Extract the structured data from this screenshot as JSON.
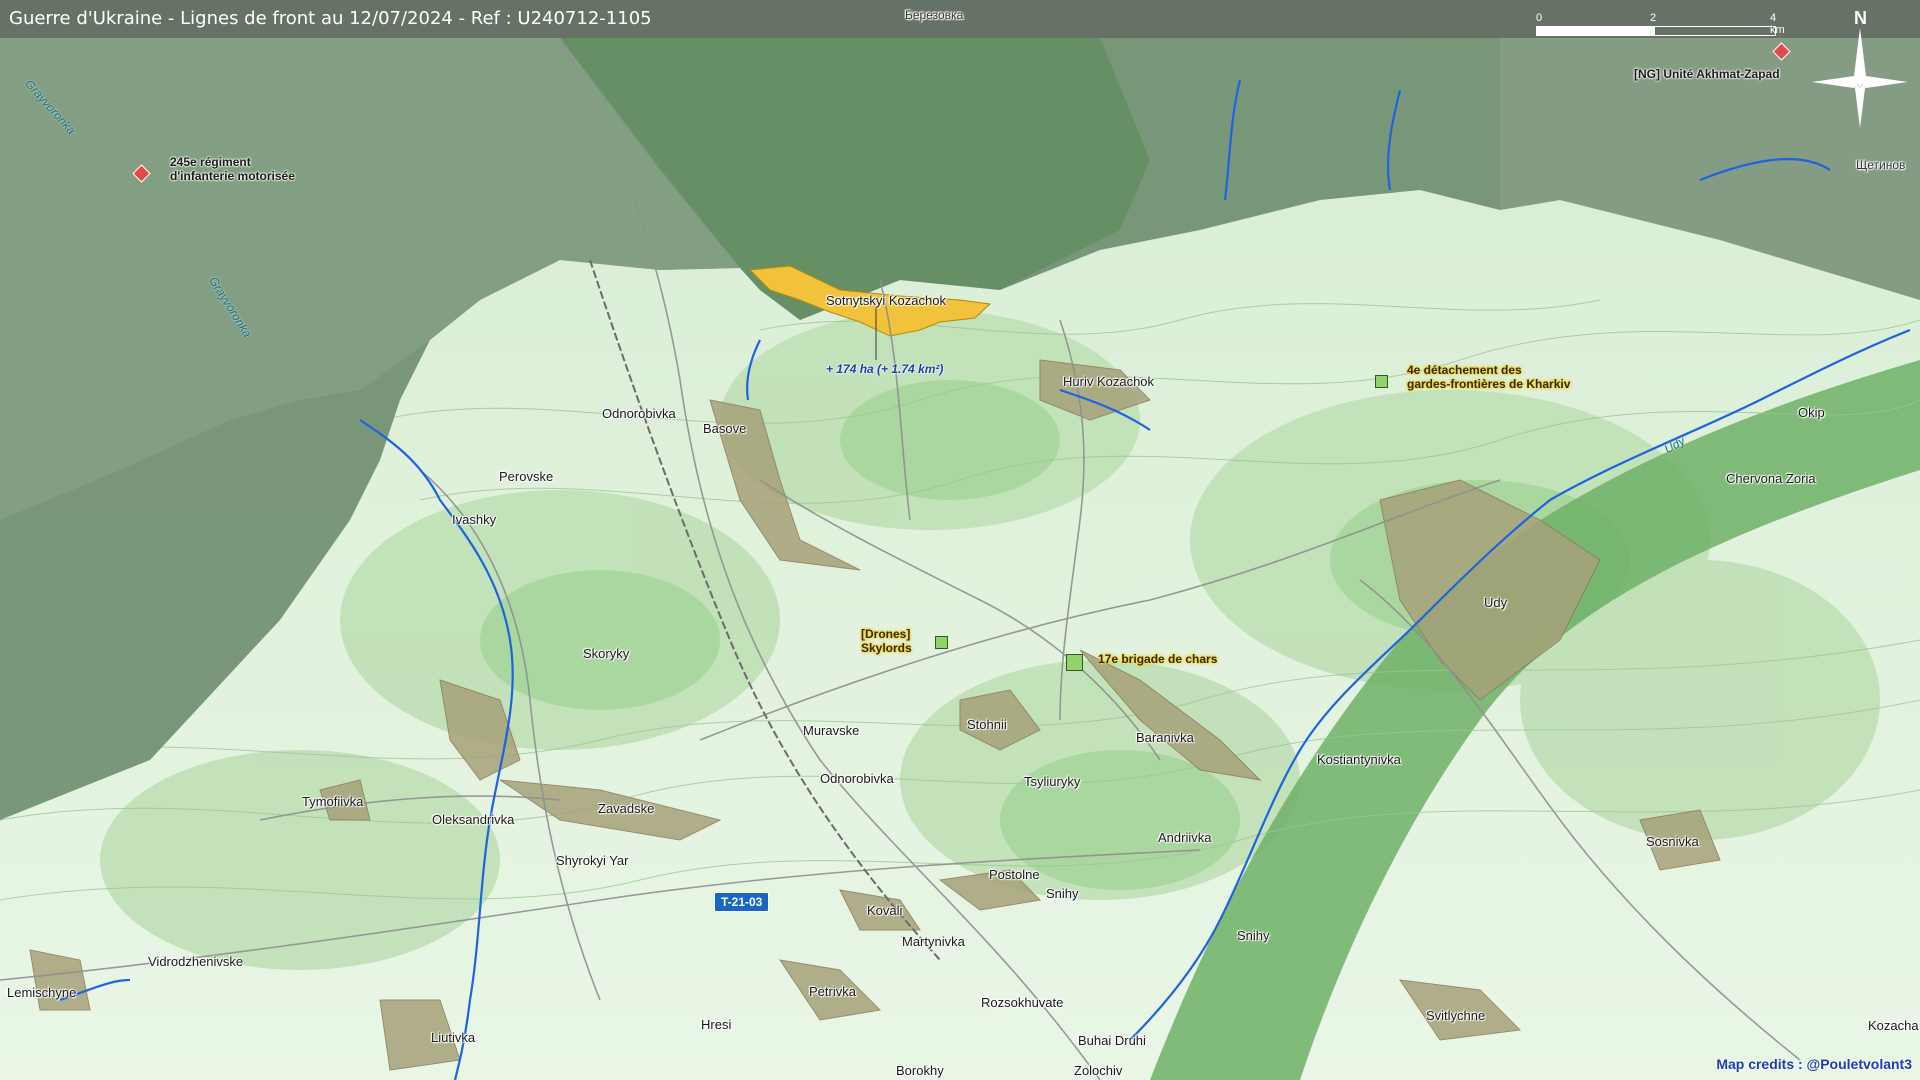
{
  "header": {
    "title": "Guerre d'Ukraine - Lignes de front au 12/07/2024 - Ref : U240712-1105"
  },
  "scale": {
    "ticks": [
      "0",
      "2",
      "4 km"
    ]
  },
  "compass": {
    "label": "N"
  },
  "credits": "Map credits : @Pouletvolant3",
  "road": {
    "label": "T-21-03"
  },
  "gain": {
    "label": "+ 174 ha (+ 1.74 km²)"
  },
  "rivers": [
    "Grayvoronka",
    "Grayvoronka",
    "Udy"
  ],
  "settlements": [
    "Березовка",
    "Щетинов",
    "Sotnytskyi Kozachok",
    "Huriv Kozachok",
    "Odnorobivka",
    "Basove",
    "Perovske",
    "Ivashky",
    "Skoryky",
    "Muravske",
    "Stohnii",
    "Baranivka",
    "Odnorobivka",
    "Tsyliuryky",
    "Oleksandrivka",
    "Zavadske",
    "Tymofiivka",
    "Shyrokyi Yar",
    "Kostiantynivka",
    "Andriivka",
    "Udy",
    "Okip",
    "Chervona Zoria",
    "Sosnivka",
    "Postolne",
    "Snihy",
    "Kovali",
    "Martynivka",
    "Snihy",
    "Vidrodzhenivske",
    "Lemischyne",
    "Petrivka",
    "Rozsokhuvate",
    "Hresi",
    "Svitlychne",
    "Liutivka",
    "Buhai Druhi",
    "Borokhy",
    "Zolochiv",
    "Kozacha"
  ],
  "units": {
    "ru": [
      {
        "name": "245e régiment\nd'infanterie motorisée"
      },
      {
        "name": "[NG] Unité Akhmat-Zapad"
      }
    ],
    "ua": [
      {
        "name": "4e détachement des\ngardes-frontières de Kharkiv"
      },
      {
        "name": "[Drones]\nSkylords"
      },
      {
        "name": "17e brigade de chars"
      }
    ]
  },
  "legend_colors": {
    "russian_control": "#6c8f6c",
    "contested": "#9aae9a",
    "ukrainian_gain": "#f2c23a",
    "water": "#1e63e0",
    "terrain_low": "#e6f4e0",
    "terrain_high": "#7fbf73"
  },
  "icons": [
    "compass-rose-icon",
    "ru-unit-icon",
    "ua-unit-icon"
  ]
}
